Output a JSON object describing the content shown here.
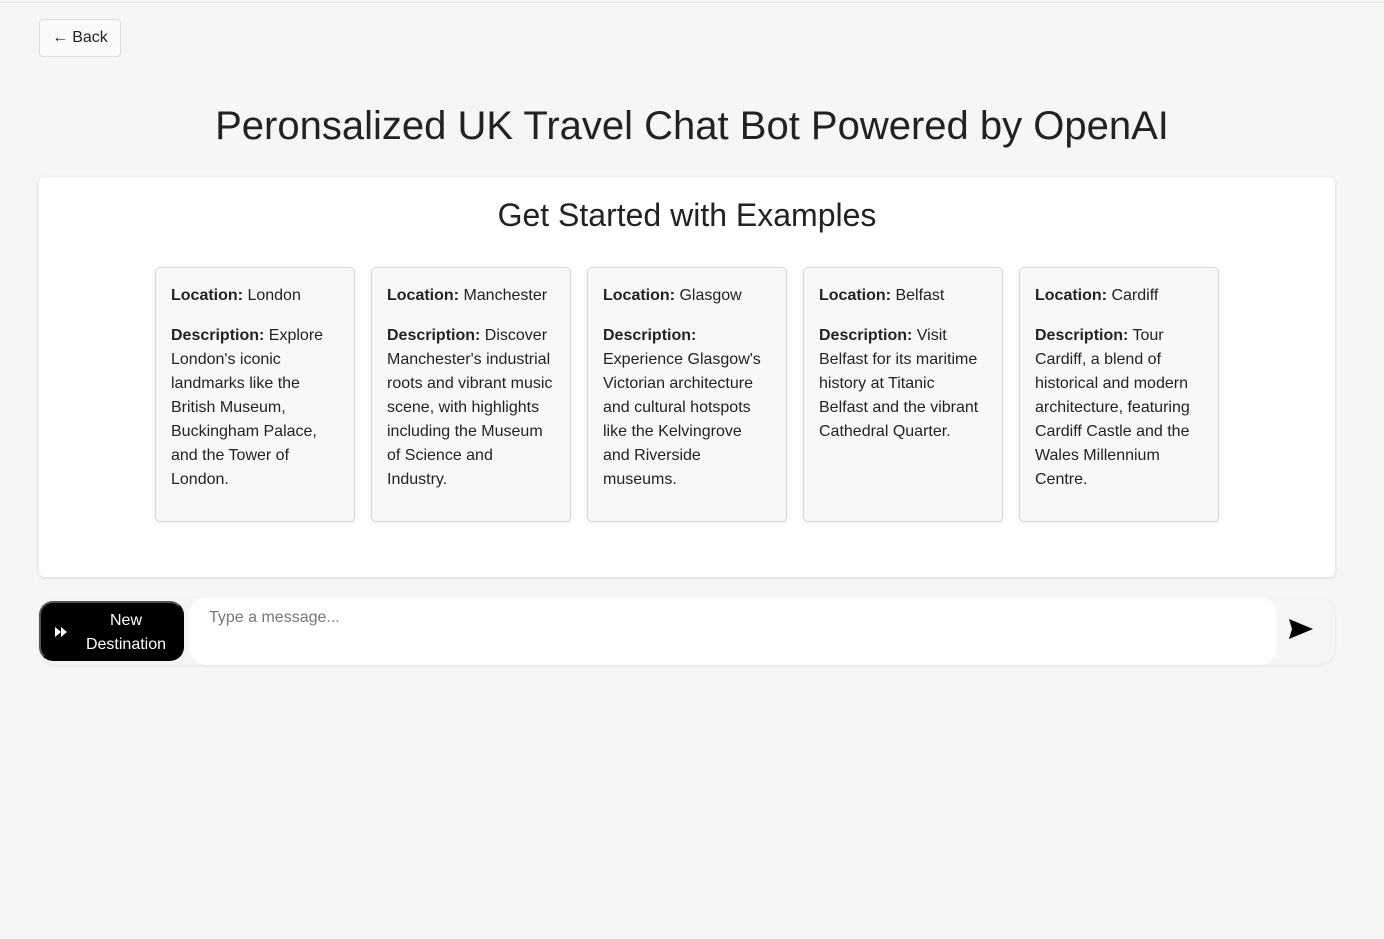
{
  "header": {
    "back_label": "Back",
    "back_arrow": "←",
    "title": "Peronsalized UK Travel Chat Bot Powered by OpenAI"
  },
  "examples": {
    "title": "Get Started with Examples",
    "location_label": "Location:",
    "description_label": "Description:",
    "cards": [
      {
        "location": "London",
        "description": "Explore London's iconic landmarks like the British Museum, Buckingham Palace, and the Tower of London."
      },
      {
        "location": "Manchester",
        "description": "Discover Manchester's industrial roots and vibrant music scene, with highlights including the Museum of Science and Industry."
      },
      {
        "location": "Glasgow",
        "description": "Experience Glasgow's Victorian architecture and cultural hotspots like the Kelvingrove and Riverside museums."
      },
      {
        "location": "Belfast",
        "description": "Visit Belfast for its maritime history at Titanic Belfast and the vibrant Cathedral Quarter."
      },
      {
        "location": "Cardiff",
        "description": "Tour Cardiff, a blend of historical and modern architecture, featuring Cardiff Castle and the Wales Millennium Centre."
      }
    ]
  },
  "chat": {
    "new_destination_label": "New Destination",
    "new_destination_icon": "fast-forward-icon",
    "input_placeholder": "Type a message...",
    "input_value": "",
    "send_icon": "send-icon"
  },
  "colors": {
    "background": "#f6f6f6",
    "panel": "#ffffff",
    "card": "#f8f8f8",
    "button_dark": "#000000",
    "text": "#222222"
  }
}
